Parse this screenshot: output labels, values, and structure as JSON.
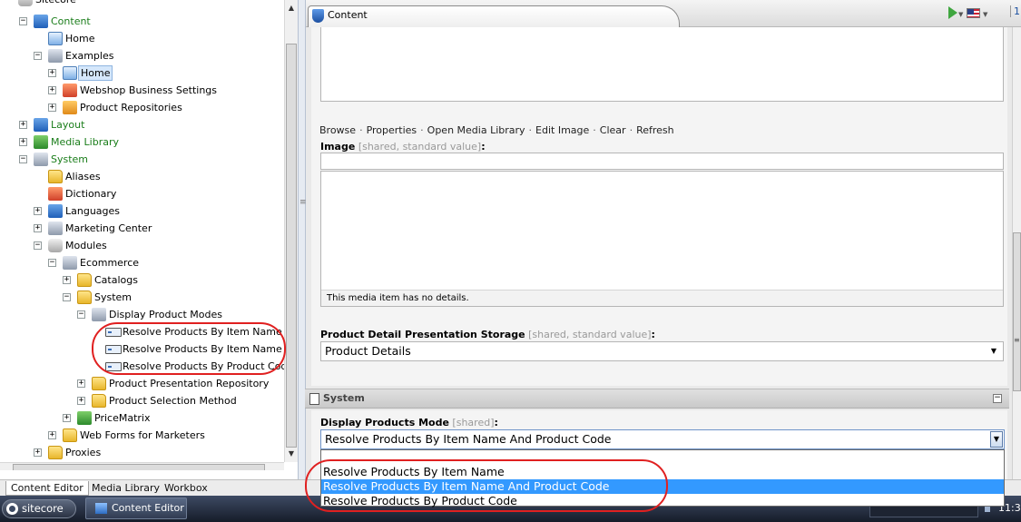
{
  "tree": {
    "items": [
      {
        "label": "Content",
        "green": true
      },
      {
        "label": "Home"
      },
      {
        "label": "Examples"
      },
      {
        "label": "Home",
        "selected": true
      },
      {
        "label": "Webshop Business Settings"
      },
      {
        "label": "Product Repositories"
      },
      {
        "label": "Layout",
        "green": true
      },
      {
        "label": "Media Library",
        "green": true
      },
      {
        "label": "System",
        "green": true
      },
      {
        "label": "Aliases"
      },
      {
        "label": "Dictionary"
      },
      {
        "label": "Languages"
      },
      {
        "label": "Marketing Center"
      },
      {
        "label": "Modules"
      },
      {
        "label": "Ecommerce"
      },
      {
        "label": "Catalogs"
      },
      {
        "label": "System"
      },
      {
        "label": "Display Product Modes"
      },
      {
        "label": "Resolve Products By Item Name"
      },
      {
        "label": "Resolve Products By Item Name And"
      },
      {
        "label": "Resolve Products By Product Code"
      },
      {
        "label": "Product Presentation Repository"
      },
      {
        "label": "Product Selection Method"
      },
      {
        "label": "PriceMatrix"
      },
      {
        "label": "Web Forms for Marketers"
      },
      {
        "label": "Proxies"
      }
    ],
    "top_cut_label": "Sitecore"
  },
  "content_tab": {
    "label": "Content"
  },
  "tab_tools": {
    "version": "1"
  },
  "image_field": {
    "actions": [
      "Browse",
      "Properties",
      "Open Media Library",
      "Edit Image",
      "Clear",
      "Refresh"
    ],
    "label": "Image",
    "meta": "[shared, standard value]",
    "colon": ":",
    "details_caption": "This media item has no details."
  },
  "storage_field": {
    "label": "Product Detail Presentation Storage",
    "meta": "[shared, standard value]",
    "colon": ":",
    "value": "Product Details"
  },
  "system_section": {
    "title": "System"
  },
  "mode_field": {
    "label": "Display Products Mode",
    "meta": "[shared]",
    "colon": ":",
    "value": "Resolve Products By Item Name And Product Code",
    "options": [
      {
        "label": "Resolve Products By Item Name",
        "selected": false
      },
      {
        "label": "Resolve Products By Item Name And Product Code",
        "selected": true
      },
      {
        "label": "Resolve Products By Product Code",
        "selected": false
      }
    ]
  },
  "bottom_tabs": [
    "Content Editor",
    "Media Library",
    "Workbox"
  ],
  "taskbar": {
    "start_label": "sitecore",
    "task_label": "Content Editor",
    "clock": "11:3"
  },
  "colors": {
    "annotation": "#e02020",
    "selection": "#3399ff",
    "tree_green": "#1a7d1a"
  },
  "icons": {
    "tree": [
      "db-icon",
      "content-icon",
      "home-icon",
      "folder-icon",
      "media-library-icon",
      "system-icon",
      "languages-icon",
      "marketing-center-icon",
      "modules-icon",
      "ecommerce-icon",
      "display-modes-icon",
      "item-icon",
      "price-matrix-icon"
    ],
    "tab": [
      "content-tab-icon",
      "navigate-icon",
      "language-flag-icon"
    ]
  }
}
